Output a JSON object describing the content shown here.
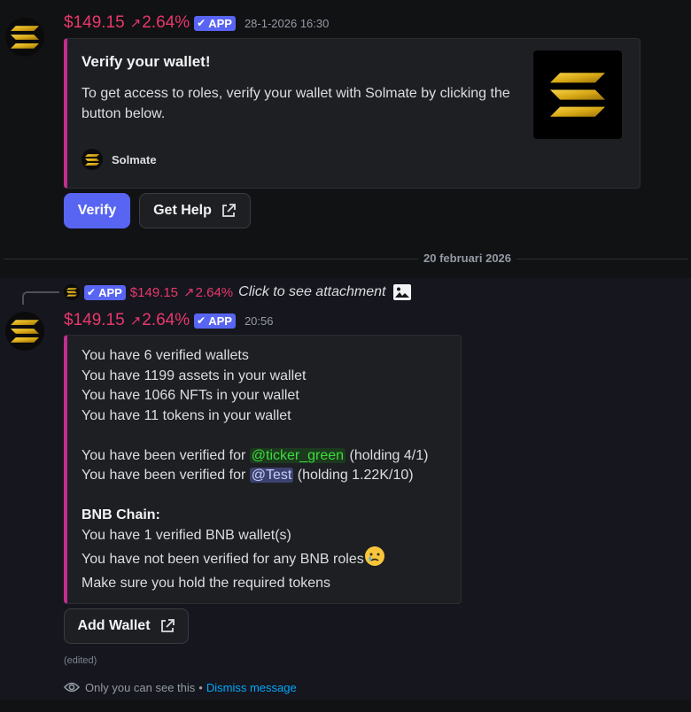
{
  "message1": {
    "username": "$149.15",
    "trend": "2.64%",
    "badge": "APP",
    "timestamp": "28-1-2026 16:30",
    "embed": {
      "title": "Verify your wallet!",
      "description": "To get access to roles, verify your wallet with Solmate by clicking the button below.",
      "footer": "Solmate"
    },
    "buttons": {
      "verify": "Verify",
      "help": "Get Help"
    }
  },
  "divider": {
    "date": "20 februari 2026"
  },
  "message2": {
    "reply": {
      "badge": "APP",
      "username": "$149.15",
      "trend": "2.64%",
      "text": "Click to see attachment"
    },
    "username": "$149.15",
    "trend": "2.64%",
    "badge": "APP",
    "timestamp": "20:56",
    "embed": {
      "line1": "You have 6 verified wallets",
      "line2": "You have 1199 assets in your wallet",
      "line3": "You have 1066 NFTs in your wallet",
      "line4": "You have 11 tokens in your wallet",
      "verified_prefix": "You have been verified for ",
      "role1": "@ticker_green",
      "role1_suffix": " (holding 4/1)",
      "role2": "@Test",
      "role2_suffix": " (holding 1.22K/10)",
      "chain_title": "BNB Chain:",
      "bnb_line1": "You have 1 verified BNB wallet(s)",
      "bnb_line2": "You have not been verified for any BNB roles",
      "bnb_line3": "Make sure you hold the required tokens"
    },
    "button": "Add Wallet",
    "edited": "(edited)",
    "ephemeral_text": "Only you can see this",
    "separator": "•",
    "dismiss": "Dismiss message"
  },
  "colors": {
    "accent": "#5865f2",
    "username": "#e8386b",
    "embed_border": "#c22d8e",
    "link": "#00a8fc"
  },
  "icons": {
    "avatar": "solana-logo-icon",
    "external": "external-link-icon",
    "attachment": "image-icon",
    "eye": "eye-icon",
    "emoji": "crying-face-emoji"
  }
}
